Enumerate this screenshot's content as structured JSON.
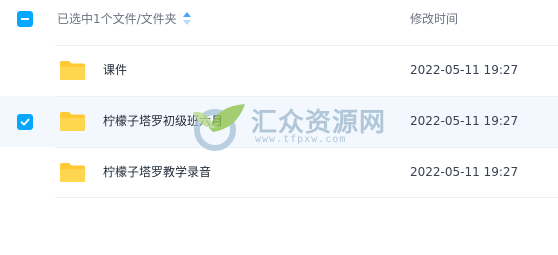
{
  "header": {
    "name_column": "已选中1个文件/文件夹",
    "date_column": "修改时间"
  },
  "files": [
    {
      "name": "课件",
      "modified": "2022-05-11 19:27",
      "selected": false
    },
    {
      "name": "柠檬子塔罗初级班六月",
      "modified": "2022-05-11 19:27",
      "selected": true
    },
    {
      "name": "柠檬子塔罗教学录音",
      "modified": "2022-05-11 19:27",
      "selected": false
    }
  ],
  "watermark": {
    "title": "汇众资源网",
    "url": "www.tfpxw.com"
  },
  "colors": {
    "accent": "#06a7ff",
    "selected_row": "#f3f8ff",
    "folder": "#ffc933"
  }
}
